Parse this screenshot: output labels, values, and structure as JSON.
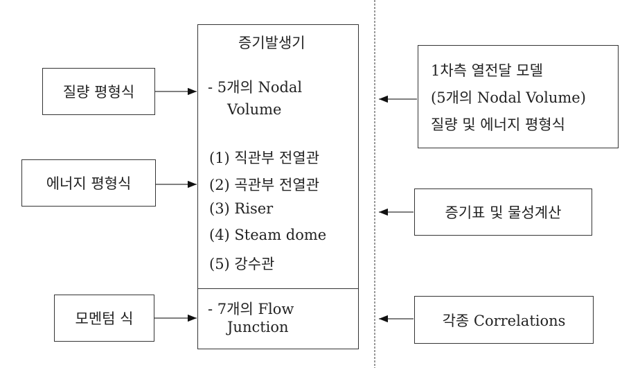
{
  "left_boxes": {
    "mass": "질량 평형식",
    "energy": "에너지 평형식",
    "momentum": "모멘텀 식"
  },
  "center": {
    "title": "증기발생기",
    "nodal_line1": "- 5개의 Nodal",
    "nodal_line2": "Volume",
    "items": [
      "(1) 직관부 전열관",
      "(2) 곡관부 전열관",
      "(3) Riser",
      "(4) Steam dome",
      "(5) 강수관"
    ],
    "flow_line1": "- 7개의 Flow",
    "flow_line2": "Junction"
  },
  "right_boxes": {
    "primary_line1": "1차측 열전달 모델",
    "primary_line2": "(5개의 Nodal Volume)",
    "primary_line3": "질량 및 에너지 평형식",
    "steam_table": "증기표 및 물성계산",
    "correlations": "각종 Correlations"
  }
}
